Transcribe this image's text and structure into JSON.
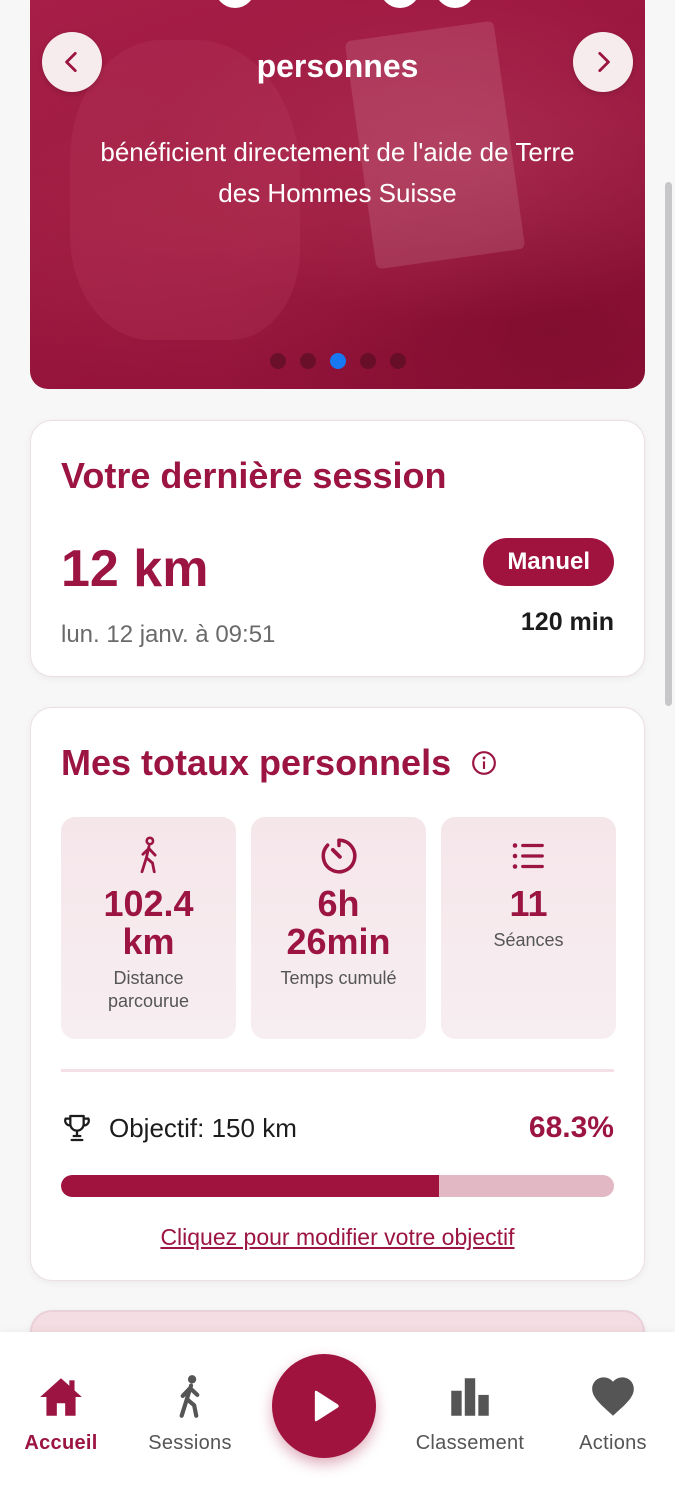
{
  "hero": {
    "title": "personnes",
    "subtitle": "bénéficient directement de l'aide de Terre des Hommes Suisse",
    "prev_icon": "chevron-left-icon",
    "next_icon": "chevron-right-icon",
    "dots_count": 5,
    "active_dot_index": 2
  },
  "last_session": {
    "title": "Votre dernière session",
    "distance": "12 km",
    "badge": "Manuel",
    "date": "lun. 12 janv. à 09:51",
    "duration": "120 min"
  },
  "totals": {
    "title": "Mes totaux personnels",
    "info_icon": "info-icon",
    "stats": [
      {
        "icon": "walking-person-icon",
        "value_line1": "102.4",
        "value_line2": "km",
        "label_line1": "Distance",
        "label_line2": "parcourue"
      },
      {
        "icon": "timer-icon",
        "value_line1": "6h",
        "value_line2": "26min",
        "label_line1": "Temps cumulé",
        "label_line2": ""
      },
      {
        "icon": "list-icon",
        "value_line1": "11",
        "value_line2": "",
        "label_line1": "Séances",
        "label_line2": ""
      }
    ],
    "goal_label": "Objectif: 150 km",
    "goal_percent": "68.3%",
    "goal_fraction": 0.683,
    "goal_link": "Cliquez pour modifier votre objectif"
  },
  "bottom_nav": {
    "items": [
      {
        "label": "Accueil",
        "icon": "home-icon",
        "active": true
      },
      {
        "label": "Sessions",
        "icon": "walking-person-icon",
        "active": false
      },
      {
        "label": "Classement",
        "icon": "bar-chart-icon",
        "active": false
      },
      {
        "label": "Actions",
        "icon": "heart-icon",
        "active": false
      }
    ],
    "play_icon": "play-icon"
  },
  "colors": {
    "brand": "#9b1442",
    "brand_button": "#a0133f",
    "progress_track": "#e2b8c4",
    "active_dot": "#1877f2"
  }
}
